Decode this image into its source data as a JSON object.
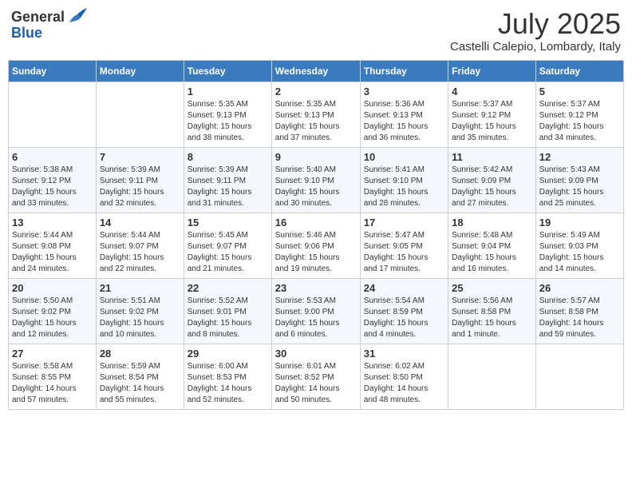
{
  "header": {
    "logo_general": "General",
    "logo_blue": "Blue",
    "month": "July 2025",
    "location": "Castelli Calepio, Lombardy, Italy"
  },
  "days_of_week": [
    "Sunday",
    "Monday",
    "Tuesday",
    "Wednesday",
    "Thursday",
    "Friday",
    "Saturday"
  ],
  "weeks": [
    [
      {
        "day": "",
        "info": ""
      },
      {
        "day": "",
        "info": ""
      },
      {
        "day": "1",
        "info": "Sunrise: 5:35 AM\nSunset: 9:13 PM\nDaylight: 15 hours\nand 38 minutes."
      },
      {
        "day": "2",
        "info": "Sunrise: 5:35 AM\nSunset: 9:13 PM\nDaylight: 15 hours\nand 37 minutes."
      },
      {
        "day": "3",
        "info": "Sunrise: 5:36 AM\nSunset: 9:13 PM\nDaylight: 15 hours\nand 36 minutes."
      },
      {
        "day": "4",
        "info": "Sunrise: 5:37 AM\nSunset: 9:12 PM\nDaylight: 15 hours\nand 35 minutes."
      },
      {
        "day": "5",
        "info": "Sunrise: 5:37 AM\nSunset: 9:12 PM\nDaylight: 15 hours\nand 34 minutes."
      }
    ],
    [
      {
        "day": "6",
        "info": "Sunrise: 5:38 AM\nSunset: 9:12 PM\nDaylight: 15 hours\nand 33 minutes."
      },
      {
        "day": "7",
        "info": "Sunrise: 5:39 AM\nSunset: 9:11 PM\nDaylight: 15 hours\nand 32 minutes."
      },
      {
        "day": "8",
        "info": "Sunrise: 5:39 AM\nSunset: 9:11 PM\nDaylight: 15 hours\nand 31 minutes."
      },
      {
        "day": "9",
        "info": "Sunrise: 5:40 AM\nSunset: 9:10 PM\nDaylight: 15 hours\nand 30 minutes."
      },
      {
        "day": "10",
        "info": "Sunrise: 5:41 AM\nSunset: 9:10 PM\nDaylight: 15 hours\nand 28 minutes."
      },
      {
        "day": "11",
        "info": "Sunrise: 5:42 AM\nSunset: 9:09 PM\nDaylight: 15 hours\nand 27 minutes."
      },
      {
        "day": "12",
        "info": "Sunrise: 5:43 AM\nSunset: 9:09 PM\nDaylight: 15 hours\nand 25 minutes."
      }
    ],
    [
      {
        "day": "13",
        "info": "Sunrise: 5:44 AM\nSunset: 9:08 PM\nDaylight: 15 hours\nand 24 minutes."
      },
      {
        "day": "14",
        "info": "Sunrise: 5:44 AM\nSunset: 9:07 PM\nDaylight: 15 hours\nand 22 minutes."
      },
      {
        "day": "15",
        "info": "Sunrise: 5:45 AM\nSunset: 9:07 PM\nDaylight: 15 hours\nand 21 minutes."
      },
      {
        "day": "16",
        "info": "Sunrise: 5:46 AM\nSunset: 9:06 PM\nDaylight: 15 hours\nand 19 minutes."
      },
      {
        "day": "17",
        "info": "Sunrise: 5:47 AM\nSunset: 9:05 PM\nDaylight: 15 hours\nand 17 minutes."
      },
      {
        "day": "18",
        "info": "Sunrise: 5:48 AM\nSunset: 9:04 PM\nDaylight: 15 hours\nand 16 minutes."
      },
      {
        "day": "19",
        "info": "Sunrise: 5:49 AM\nSunset: 9:03 PM\nDaylight: 15 hours\nand 14 minutes."
      }
    ],
    [
      {
        "day": "20",
        "info": "Sunrise: 5:50 AM\nSunset: 9:02 PM\nDaylight: 15 hours\nand 12 minutes."
      },
      {
        "day": "21",
        "info": "Sunrise: 5:51 AM\nSunset: 9:02 PM\nDaylight: 15 hours\nand 10 minutes."
      },
      {
        "day": "22",
        "info": "Sunrise: 5:52 AM\nSunset: 9:01 PM\nDaylight: 15 hours\nand 8 minutes."
      },
      {
        "day": "23",
        "info": "Sunrise: 5:53 AM\nSunset: 9:00 PM\nDaylight: 15 hours\nand 6 minutes."
      },
      {
        "day": "24",
        "info": "Sunrise: 5:54 AM\nSunset: 8:59 PM\nDaylight: 15 hours\nand 4 minutes."
      },
      {
        "day": "25",
        "info": "Sunrise: 5:56 AM\nSunset: 8:58 PM\nDaylight: 15 hours\nand 1 minute."
      },
      {
        "day": "26",
        "info": "Sunrise: 5:57 AM\nSunset: 8:58 PM\nDaylight: 14 hours\nand 59 minutes."
      }
    ],
    [
      {
        "day": "27",
        "info": "Sunrise: 5:58 AM\nSunset: 8:55 PM\nDaylight: 14 hours\nand 57 minutes."
      },
      {
        "day": "28",
        "info": "Sunrise: 5:59 AM\nSunset: 8:54 PM\nDaylight: 14 hours\nand 55 minutes."
      },
      {
        "day": "29",
        "info": "Sunrise: 6:00 AM\nSunset: 8:53 PM\nDaylight: 14 hours\nand 52 minutes."
      },
      {
        "day": "30",
        "info": "Sunrise: 6:01 AM\nSunset: 8:52 PM\nDaylight: 14 hours\nand 50 minutes."
      },
      {
        "day": "31",
        "info": "Sunrise: 6:02 AM\nSunset: 8:50 PM\nDaylight: 14 hours\nand 48 minutes."
      },
      {
        "day": "",
        "info": ""
      },
      {
        "day": "",
        "info": ""
      }
    ]
  ]
}
